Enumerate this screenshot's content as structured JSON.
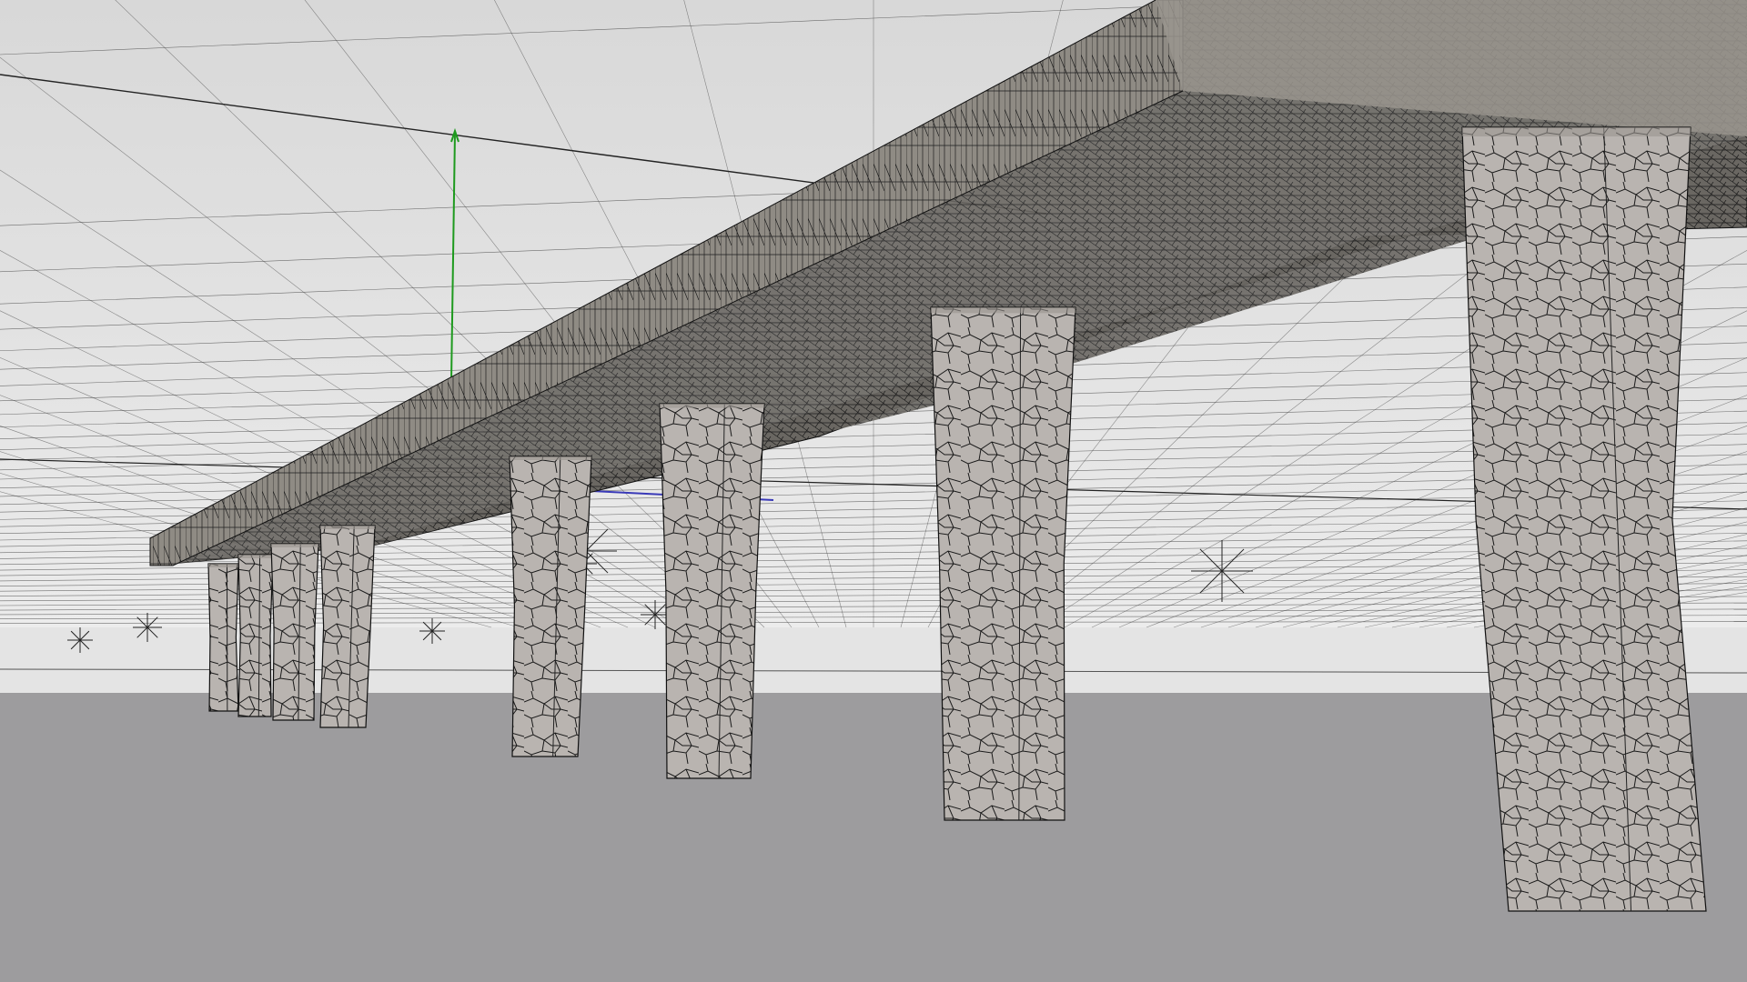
{
  "viewport": {
    "kind": "3d-perspective-viewport",
    "render_mode": "wireframe-on-shaded",
    "colors": {
      "sky": "#dcdcdc",
      "horizon_band": "#e6e6e6",
      "ground": "#9d9c9e",
      "grid_line": "#3c3c3c",
      "axis_y": "#1e9a1e",
      "axis_x": "#3a3ab8",
      "deck_side": "#8e8a82",
      "deck_under": "#5c5a56",
      "pillar_fill": "#b9b4b0",
      "mesh_line": "#141414"
    },
    "scene": {
      "deck": {
        "name": "bridge-deck",
        "material": "concrete-texture"
      },
      "pillars": [
        {
          "name": "pillar-1"
        },
        {
          "name": "pillar-2"
        },
        {
          "name": "pillar-3"
        },
        {
          "name": "pillar-4"
        },
        {
          "name": "pillar-5"
        },
        {
          "name": "pillar-6"
        },
        {
          "name": "pillar-7"
        },
        {
          "name": "pillar-8"
        }
      ],
      "light_markers": 7
    }
  }
}
